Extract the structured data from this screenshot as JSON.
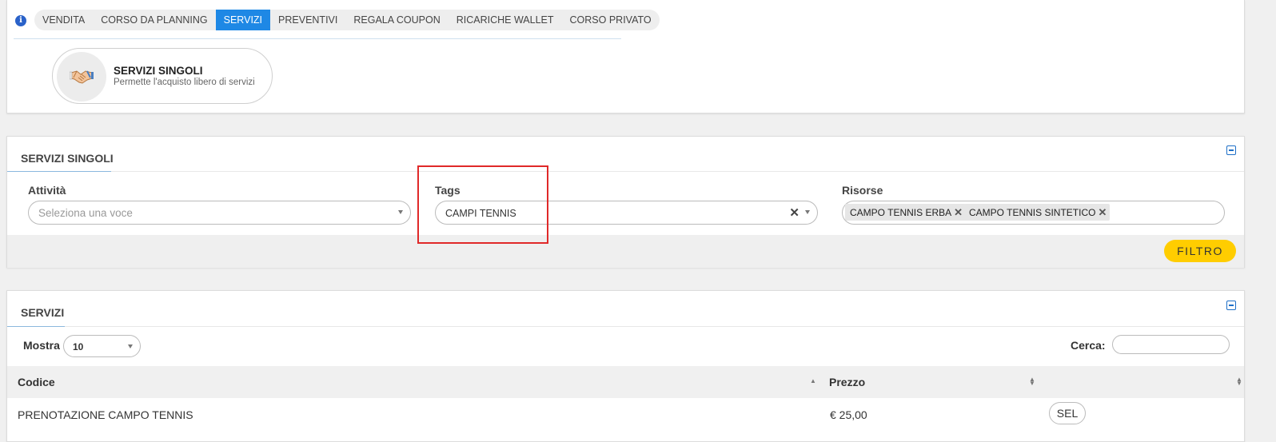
{
  "tabs": [
    {
      "label": "VENDITA",
      "active": false
    },
    {
      "label": "CORSO DA PLANNING",
      "active": false
    },
    {
      "label": "SERVIZI",
      "active": true
    },
    {
      "label": "PREVENTIVI",
      "active": false
    },
    {
      "label": "REGALA COUPON",
      "active": false
    },
    {
      "label": "RICARICHE WALLET",
      "active": false
    },
    {
      "label": "CORSO PRIVATO",
      "active": false
    }
  ],
  "service_card": {
    "title": "SERVIZI SINGOLI",
    "subtitle": "Permette l'acquisto libero di servizi",
    "icon": "handshake-icon"
  },
  "filter_panel": {
    "title": "SERVIZI SINGOLI",
    "attivita": {
      "label": "Attività",
      "placeholder": "Seleziona una voce"
    },
    "tags": {
      "label": "Tags",
      "value": "CAMPI TENNIS"
    },
    "risorse": {
      "label": "Risorse",
      "chips": [
        "CAMPO TENNIS ERBA",
        "CAMPO TENNIS SINTETICO"
      ]
    },
    "filter_button": "FILTRO"
  },
  "table_panel": {
    "title": "SERVIZI",
    "mostra_label": "Mostra",
    "mostra_value": "10",
    "cerca_label": "Cerca:",
    "columns": [
      "Codice",
      "Prezzo"
    ],
    "rows": [
      {
        "codice": "PRENOTAZIONE CAMPO TENNIS",
        "prezzo": "€ 25,00",
        "action": "SEL"
      }
    ]
  },
  "colors": {
    "accent": "#1e88e5",
    "filter_button": "#ffcd00",
    "highlight": "#e02929"
  }
}
